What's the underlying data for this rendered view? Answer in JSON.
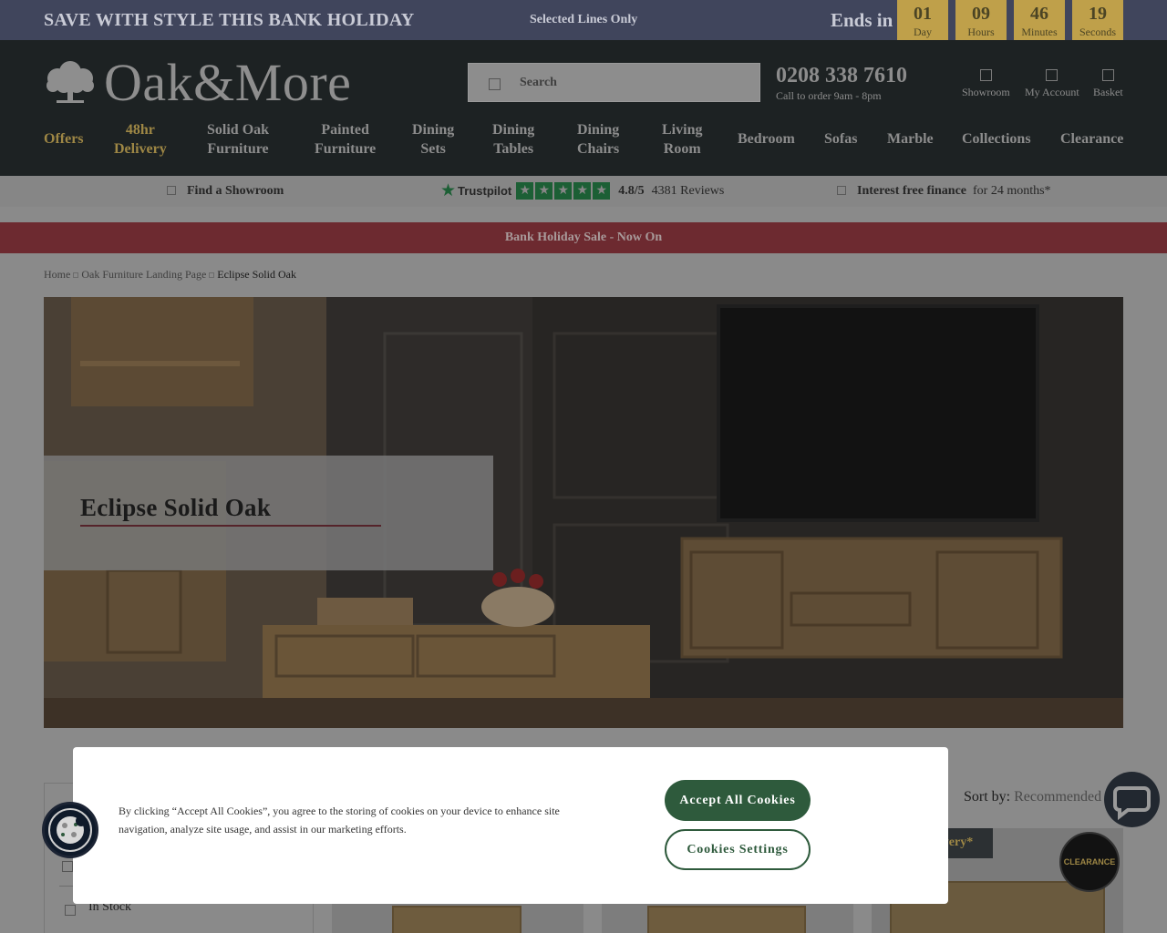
{
  "promo": {
    "title": "SAVE WITH STYLE THIS BANK HOLIDAY",
    "subtitle": "Selected Lines Only",
    "ends_label": "Ends in",
    "countdown": [
      {
        "value": "01",
        "label": "Day"
      },
      {
        "value": "09",
        "label": "Hours"
      },
      {
        "value": "46",
        "label": "Minutes"
      },
      {
        "value": "19",
        "label": "Seconds"
      }
    ]
  },
  "header": {
    "logo_text": "Oak&More",
    "search_placeholder": "Search",
    "phone": "0208 338 7610",
    "phone_hours": "Call to order 9am - 8pm",
    "icons": [
      {
        "label": "Showroom",
        "icon": "showroom-icon"
      },
      {
        "label": "My Account",
        "icon": "account-icon"
      },
      {
        "label": "Basket",
        "icon": "basket-icon"
      }
    ]
  },
  "nav": [
    {
      "line1": "Offers",
      "line2": ""
    },
    {
      "line1": "48hr",
      "line2": "Delivery"
    },
    {
      "line1": "Solid Oak",
      "line2": "Furniture"
    },
    {
      "line1": "Painted",
      "line2": "Furniture"
    },
    {
      "line1": "Dining",
      "line2": "Sets"
    },
    {
      "line1": "Dining",
      "line2": "Tables"
    },
    {
      "line1": "Dining",
      "line2": "Chairs"
    },
    {
      "line1": "Living",
      "line2": "Room"
    },
    {
      "line1": "Bedroom",
      "line2": ""
    },
    {
      "line1": "Sofas",
      "line2": ""
    },
    {
      "line1": "Marble",
      "line2": ""
    },
    {
      "line1": "Collections",
      "line2": ""
    },
    {
      "line1": "Clearance",
      "line2": ""
    }
  ],
  "trust": {
    "showroom": "Find a Showroom",
    "trustpilot_name": "Trustpilot",
    "stars": 5,
    "rating": "4.8/5",
    "reviews": "4381 Reviews",
    "finance_bold": "Interest free finance",
    "finance_rest": "for 24 months*"
  },
  "sale_banner": "Bank Holiday Sale - Now On",
  "breadcrumb": [
    "Home",
    "Oak Furniture Landing Page",
    "Eclipse Solid Oak"
  ],
  "hero": {
    "title": "Eclipse Solid Oak"
  },
  "listing": {
    "sort_label": "Sort by:",
    "sort_value": "Recommended",
    "filter_in_stock": "In Stock",
    "badge_delivery": "livery*",
    "badge_clearance": "CLEARANCE"
  },
  "cookie": {
    "text": "By clicking “Accept All Cookies”, you agree to the storing of cookies on your device to enhance site navigation, analyze site usage, and assist in our marketing efforts.",
    "accept": "Accept All Cookies",
    "settings": "Cookies Settings"
  },
  "colors": {
    "promo_bg": "#40455c",
    "gold": "#bfa04a",
    "header_bg": "#1d2223",
    "sale_bg": "#6d2a30",
    "accept_green": "#2e5a3c"
  }
}
